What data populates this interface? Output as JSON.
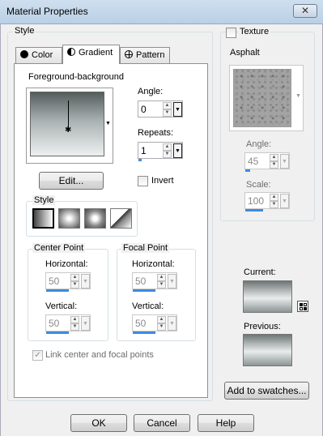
{
  "window": {
    "title": "Material Properties",
    "close_glyph": "✕"
  },
  "style_group": {
    "legend": "Style",
    "tabs": [
      {
        "label": "Color",
        "icon": "filled-circle-icon"
      },
      {
        "label": "Gradient",
        "icon": "half-circle-icon"
      },
      {
        "label": "Pattern",
        "icon": "pattern-icon"
      }
    ],
    "active_tab": "Gradient"
  },
  "gradient": {
    "preset_label": "Foreground-background",
    "edit_label": "Edit...",
    "angle_label": "Angle:",
    "angle_value": "0",
    "repeats_label": "Repeats:",
    "repeats_value": "1",
    "invert_label": "Invert",
    "invert_checked": false,
    "style_legend": "Style",
    "style_types": [
      "linear",
      "rectangular",
      "sunburst",
      "radial"
    ],
    "center_point": {
      "legend": "Center Point",
      "horizontal_label": "Horizontal:",
      "horizontal_value": "50",
      "vertical_label": "Vertical:",
      "vertical_value": "50"
    },
    "focal_point": {
      "legend": "Focal Point",
      "horizontal_label": "Horizontal:",
      "horizontal_value": "50",
      "vertical_label": "Vertical:",
      "vertical_value": "50"
    },
    "link_label": "Link center and focal points",
    "link_checked": true
  },
  "texture": {
    "label": "Texture",
    "checked": false,
    "name": "Asphalt",
    "angle_label": "Angle:",
    "angle_value": "45",
    "scale_label": "Scale:",
    "scale_value": "100"
  },
  "preview": {
    "current_label": "Current:",
    "previous_label": "Previous:",
    "swatches_button": "Add to swatches..."
  },
  "footer": {
    "ok": "OK",
    "cancel": "Cancel",
    "help": "Help"
  },
  "colors": {
    "accent": "#3c8be0",
    "window_bg": "#f0f0f0",
    "titlebar": "#c4d7ea"
  }
}
